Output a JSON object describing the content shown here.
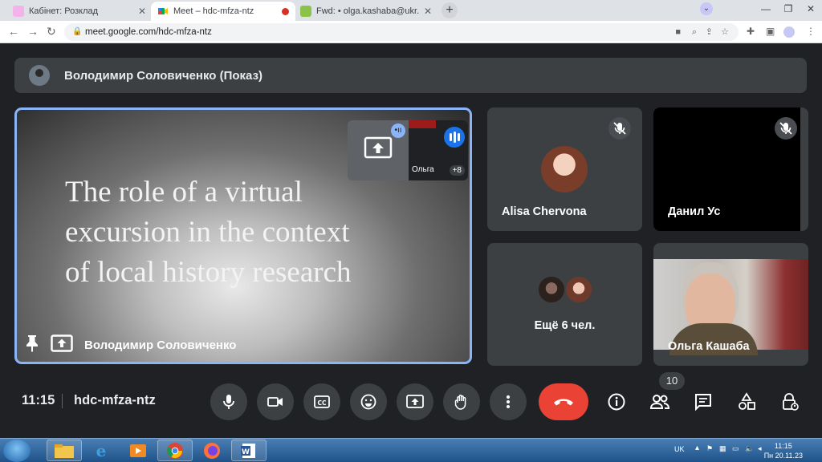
{
  "browser": {
    "tabs": [
      {
        "title": "Кабінет: Розклад",
        "active": false
      },
      {
        "title": "Meet – hdc-mfza-ntz",
        "active": true
      },
      {
        "title": "Fwd: • olga.kashaba@ukr.net",
        "active": false
      }
    ],
    "new_tab": "+",
    "url": "meet.google.com/hdc-mfza-ntz"
  },
  "meet": {
    "presenting_banner": "Володимир Соловиченко (Показ)",
    "slide_lines": [
      "The role of a virtual",
      "excursion in the context",
      "of local history research"
    ],
    "presenter_name": "Володимир Соловиченко",
    "self_name": "Ольга",
    "self_more": "+8",
    "tiles": [
      {
        "name": "Alisa Chervona"
      },
      {
        "name": "Данил Ус"
      },
      {
        "name": "Ещё 6 чел."
      },
      {
        "name": "Ольга Кашаба"
      }
    ],
    "clock": "11:15",
    "meeting_code": "hdc-mfza-ntz",
    "participants_count": "10"
  },
  "colors": {
    "accent": "#8ab4f8",
    "end_call": "#ea4335",
    "tile_bg": "#3c4043",
    "page_bg": "#202124"
  },
  "taskbar": {
    "lang": "UK",
    "time": "11:15",
    "date": "Пн 20.11.23"
  }
}
